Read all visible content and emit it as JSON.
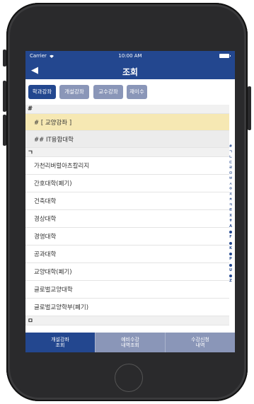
{
  "status_bar": {
    "carrier": "Carrier",
    "time": "10:00 AM"
  },
  "nav": {
    "back_symbol": "◀",
    "title": "조회"
  },
  "tabs": [
    {
      "label": "학과강좌",
      "active": true
    },
    {
      "label": "개설강좌",
      "active": false
    },
    {
      "label": "교수강좌",
      "active": false
    },
    {
      "label": "재이수",
      "active": false
    }
  ],
  "list": {
    "rows": [
      {
        "type": "header",
        "label": "#"
      },
      {
        "type": "highlight",
        "label": "# [ 교양강좌 ]"
      },
      {
        "type": "sub",
        "label": "## IT융합대학"
      },
      {
        "type": "header",
        "label": "ㄱ"
      },
      {
        "type": "item",
        "label": "가천리버럴아츠칼리지"
      },
      {
        "type": "item",
        "label": "간호대학(폐기)"
      },
      {
        "type": "item",
        "label": "건축대학"
      },
      {
        "type": "item",
        "label": "경상대학"
      },
      {
        "type": "item",
        "label": "경영대학"
      },
      {
        "type": "item",
        "label": "공과대학"
      },
      {
        "type": "item",
        "label": "교양대학(폐기)"
      },
      {
        "type": "item",
        "label": "글로벌교양대학"
      },
      {
        "type": "item",
        "label": "글로벌교양학부(폐기)"
      },
      {
        "type": "header",
        "label": "ㅁ"
      }
    ]
  },
  "index_bar": [
    "#",
    "ㄱ",
    "ㄴ",
    "ㄷ",
    "ㄹ",
    "ㅁ",
    "ㅂ",
    "ㅅ",
    "ㅇ",
    "ㅈ",
    "ㅊ",
    "ㅋ",
    "ㅌ",
    "ㅍ",
    "ㅎ",
    "A",
    "•",
    "F",
    "•",
    "K",
    "•",
    "P",
    "•",
    "U",
    "•",
    "Z"
  ],
  "bottom_bar": [
    {
      "line1": "개설강좌",
      "line2": "조회",
      "active": true
    },
    {
      "line1": "예비수강",
      "line2": "내역조회",
      "active": false
    },
    {
      "line1": "수강신청",
      "line2": "내역",
      "active": false
    }
  ],
  "colors": {
    "primary": "#23478f",
    "inactive_tab": "#8a96b8",
    "highlight_row": "#f6e8b3"
  }
}
